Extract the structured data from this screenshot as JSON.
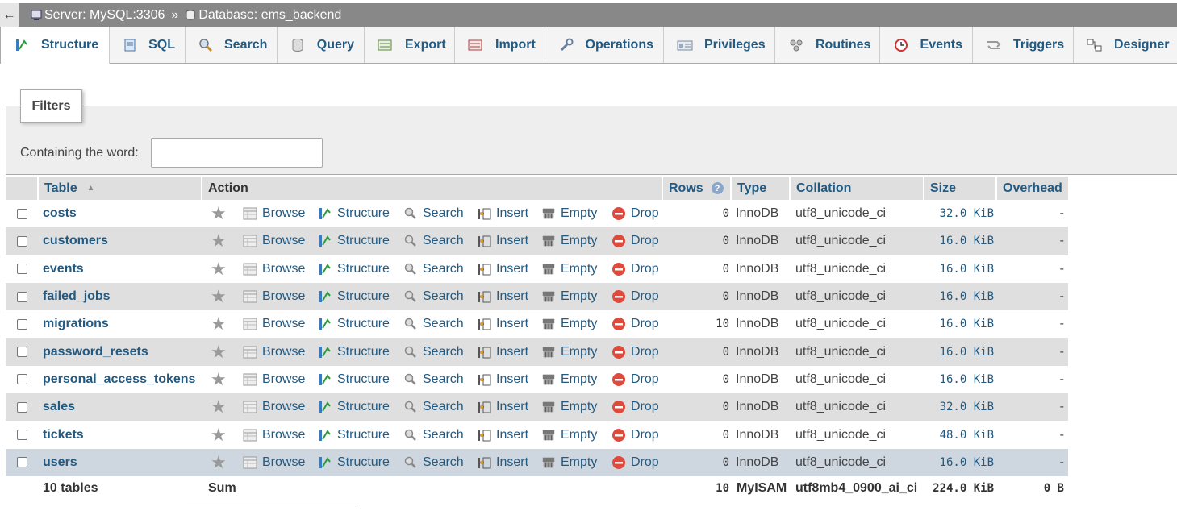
{
  "breadcrumb": {
    "back": "←",
    "server": "Server: MySQL:3306",
    "separator": "»",
    "database": "Database: ems_backend"
  },
  "tabs": [
    {
      "label": "Structure",
      "icon": "structure-icon"
    },
    {
      "label": "SQL",
      "icon": "sql-icon"
    },
    {
      "label": "Search",
      "icon": "search-icon"
    },
    {
      "label": "Query",
      "icon": "query-icon"
    },
    {
      "label": "Export",
      "icon": "export-icon"
    },
    {
      "label": "Import",
      "icon": "import-icon"
    },
    {
      "label": "Operations",
      "icon": "wrench-icon"
    },
    {
      "label": "Privileges",
      "icon": "privileges-icon"
    },
    {
      "label": "Routines",
      "icon": "routines-icon"
    },
    {
      "label": "Events",
      "icon": "clock-icon"
    },
    {
      "label": "Triggers",
      "icon": "triggers-icon"
    },
    {
      "label": "Designer",
      "icon": "designer-icon"
    }
  ],
  "filters": {
    "legend": "Filters",
    "label": "Containing the word:",
    "value": ""
  },
  "table": {
    "headers": {
      "table": "Table",
      "action": "Action",
      "rows": "Rows",
      "type": "Type",
      "collation": "Collation",
      "size": "Size",
      "overhead": "Overhead"
    },
    "actions": {
      "browse": "Browse",
      "structure": "Structure",
      "search": "Search",
      "insert": "Insert",
      "empty": "Empty",
      "drop": "Drop"
    },
    "rows": [
      {
        "name": "costs",
        "rows": "0",
        "type": "InnoDB",
        "collation": "utf8_unicode_ci",
        "size": "32.0 KiB",
        "overhead": "-"
      },
      {
        "name": "customers",
        "rows": "0",
        "type": "InnoDB",
        "collation": "utf8_unicode_ci",
        "size": "16.0 KiB",
        "overhead": "-"
      },
      {
        "name": "events",
        "rows": "0",
        "type": "InnoDB",
        "collation": "utf8_unicode_ci",
        "size": "16.0 KiB",
        "overhead": "-"
      },
      {
        "name": "failed_jobs",
        "rows": "0",
        "type": "InnoDB",
        "collation": "utf8_unicode_ci",
        "size": "16.0 KiB",
        "overhead": "-"
      },
      {
        "name": "migrations",
        "rows": "10",
        "type": "InnoDB",
        "collation": "utf8_unicode_ci",
        "size": "16.0 KiB",
        "overhead": "-"
      },
      {
        "name": "password_resets",
        "rows": "0",
        "type": "InnoDB",
        "collation": "utf8_unicode_ci",
        "size": "16.0 KiB",
        "overhead": "-"
      },
      {
        "name": "personal_access_tokens",
        "rows": "0",
        "type": "InnoDB",
        "collation": "utf8_unicode_ci",
        "size": "16.0 KiB",
        "overhead": "-"
      },
      {
        "name": "sales",
        "rows": "0",
        "type": "InnoDB",
        "collation": "utf8_unicode_ci",
        "size": "32.0 KiB",
        "overhead": "-"
      },
      {
        "name": "tickets",
        "rows": "0",
        "type": "InnoDB",
        "collation": "utf8_unicode_ci",
        "size": "48.0 KiB",
        "overhead": "-"
      },
      {
        "name": "users",
        "rows": "0",
        "type": "InnoDB",
        "collation": "utf8_unicode_ci",
        "size": "16.0 KiB",
        "overhead": "-"
      }
    ],
    "footer": {
      "count": "10 tables",
      "sum": "Sum",
      "rows": "10",
      "type": "MyISAM",
      "collation": "utf8mb4_0900_ai_ci",
      "size": "224.0 KiB",
      "overhead": "0 B"
    }
  },
  "colors": {
    "link": "#235a81",
    "drop": "#e04a3c",
    "row_alt": "#dfdfdf",
    "row_hover": "#ced6df",
    "crumb_bg": "#888888"
  }
}
